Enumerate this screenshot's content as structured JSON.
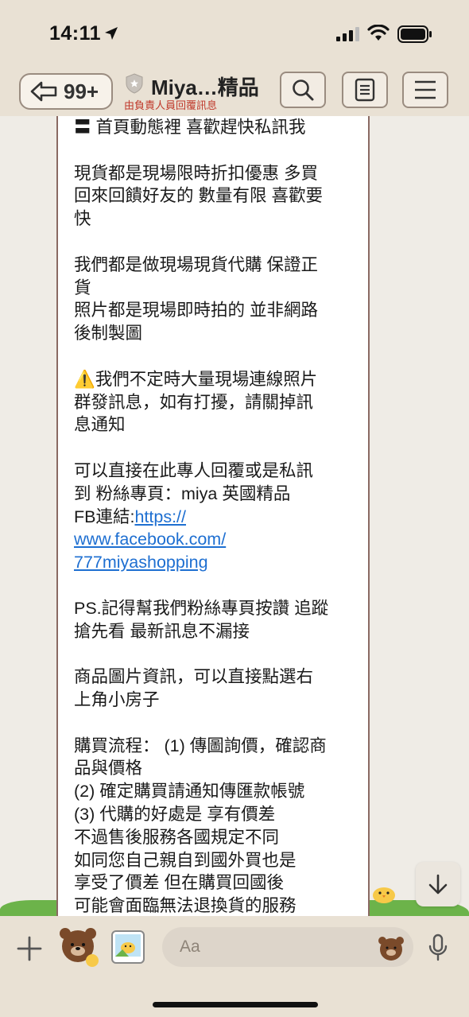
{
  "status": {
    "time": "14:11"
  },
  "header": {
    "back_count": "99+",
    "title": "Miya…精品",
    "subtitle": "由負責人員回覆訊息"
  },
  "message": {
    "lines": [
      "〓 首頁動態裡 喜歡趕快私訊我",
      "",
      "現貨都是現場限時折扣優惠 多買",
      "回來回饋好友的 數量有限 喜歡要",
      "快",
      "",
      "我們都是做現場現貨代購 保證正",
      "貨",
      "照片都是現場即時拍的  並非網路",
      "後制製圖",
      "",
      "⚠️我們不定時大量現場連線照片",
      "群發訊息，如有打擾，請關掉訊",
      "息通知",
      "",
      "可以直接在此專人回覆或是私訊",
      "到 粉絲專頁：miya 英國精品"
    ],
    "link_prefix": "FB連結:",
    "link_part1": "https://",
    "link_part2": "www.facebook.com/",
    "link_part3": "777miyashopping",
    "lines2": [
      "",
      "PS.記得幫我們粉絲專頁按讚 追蹤",
      "搶先看 最新訊息不漏接",
      "",
      "商品圖片資訊，可以直接點選右",
      "上角小房子",
      "",
      "購買流程： (1) 傳圖詢價，確認商",
      "品與價格",
      "(2) 確定購買請通知傳匯款帳號",
      "(3) 代購的好處是 享有價差",
      "不過售後服務各國規定不同",
      "如同您自己親自到國外買也是",
      "享受了價差 但在購買回國後",
      "可能會面臨無法退換貨的服務"
    ]
  },
  "input": {
    "placeholder": "Aa"
  },
  "icons": {
    "back": "arrow-left-icon",
    "search": "search-icon",
    "note": "note-icon",
    "menu": "menu-icon",
    "scroll": "arrow-down-icon",
    "plus": "plus-icon",
    "sticker": "sticker-icon",
    "photo": "photo-icon",
    "emoji": "emoji-icon",
    "mic": "mic-icon"
  },
  "colors": {
    "link": "#1e6fd1",
    "subtitle": "#c0392b"
  }
}
